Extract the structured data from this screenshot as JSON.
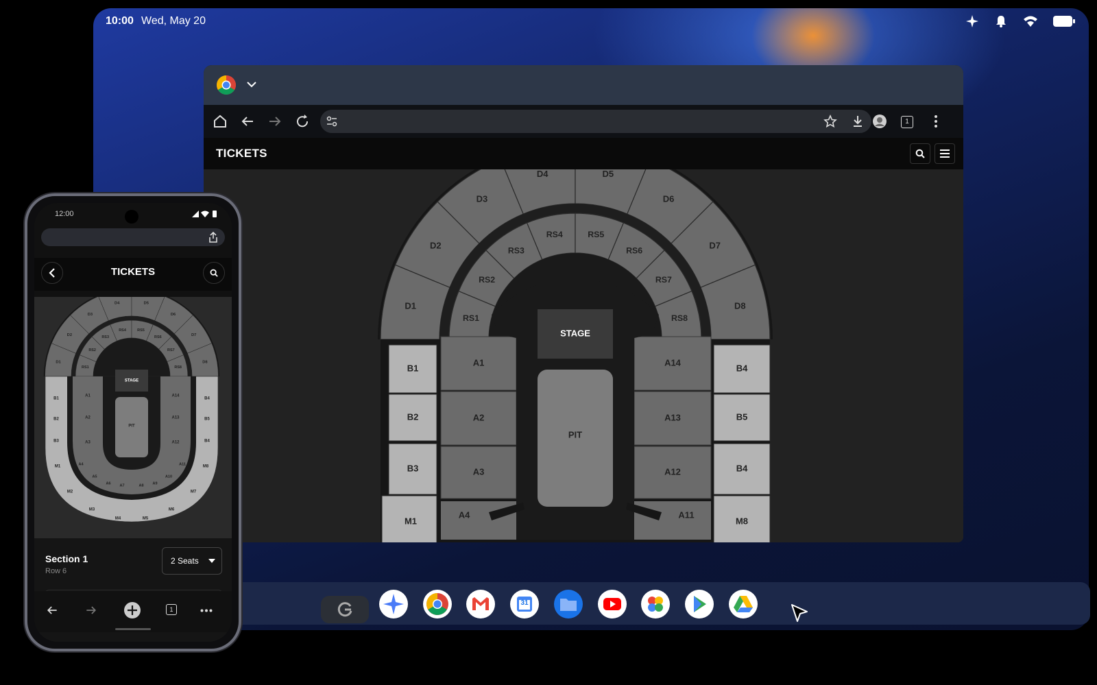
{
  "status_bar": {
    "time": "10:00",
    "date": "Wed, May 20"
  },
  "browser": {
    "site_title": "TICKETS"
  },
  "seat_map": {
    "stage": "STAGE",
    "pit": "PIT",
    "sections_upper": [
      "D1",
      "D2",
      "D3",
      "D4",
      "D5",
      "D6",
      "D7",
      "D8"
    ],
    "sections_rs": [
      "RS1",
      "RS2",
      "RS3",
      "RS4",
      "RS5",
      "RS6",
      "RS7",
      "RS8"
    ],
    "sections_a_left": [
      "A1",
      "A2",
      "A3",
      "A4"
    ],
    "sections_a_right": [
      "A14",
      "A13",
      "A12",
      "A11"
    ],
    "sections_b_left": [
      "B1",
      "B2",
      "B3"
    ],
    "sections_b_right": [
      "B4",
      "B5",
      "B4"
    ],
    "sections_m": [
      "M1",
      "M8"
    ]
  },
  "phone": {
    "time": "12:00",
    "title": "TICKETS",
    "section_label": "Section 1",
    "row_label": "Row 6",
    "seats_select": "2 Seats",
    "tab_count": "1",
    "map": {
      "stage": "STAGE",
      "pit": "PIT",
      "d": [
        "D1",
        "D2",
        "D3",
        "D4",
        "D5",
        "D6",
        "D7",
        "D8"
      ],
      "rs": [
        "RS1",
        "RS2",
        "RS3",
        "RS4",
        "RS5",
        "RS6",
        "RS7",
        "RS8"
      ],
      "a_left": [
        "A1",
        "A2",
        "A3",
        "A4",
        "A5",
        "A6",
        "A7"
      ],
      "a_right": [
        "A14",
        "A13",
        "A12",
        "A11",
        "A10",
        "A9",
        "A8"
      ],
      "b_left": [
        "B1",
        "B2",
        "B3"
      ],
      "b_right": [
        "B4",
        "B5",
        "B4"
      ],
      "m": [
        "M1",
        "M2",
        "M3",
        "M4",
        "M5",
        "M6",
        "M7",
        "M8"
      ]
    }
  },
  "toolbar": {
    "tab_count": "1"
  },
  "dock": {
    "apps": [
      "google-search",
      "gemini",
      "chrome",
      "gmail",
      "calendar",
      "files",
      "youtube",
      "photos",
      "play-store",
      "drive"
    ],
    "calendar_day": "31"
  },
  "colors": {
    "accent_blue": "#1a73e8",
    "section_dark": "#6b6b6b",
    "section_light": "#b4b4b4",
    "stage": "#3a3a3a"
  }
}
